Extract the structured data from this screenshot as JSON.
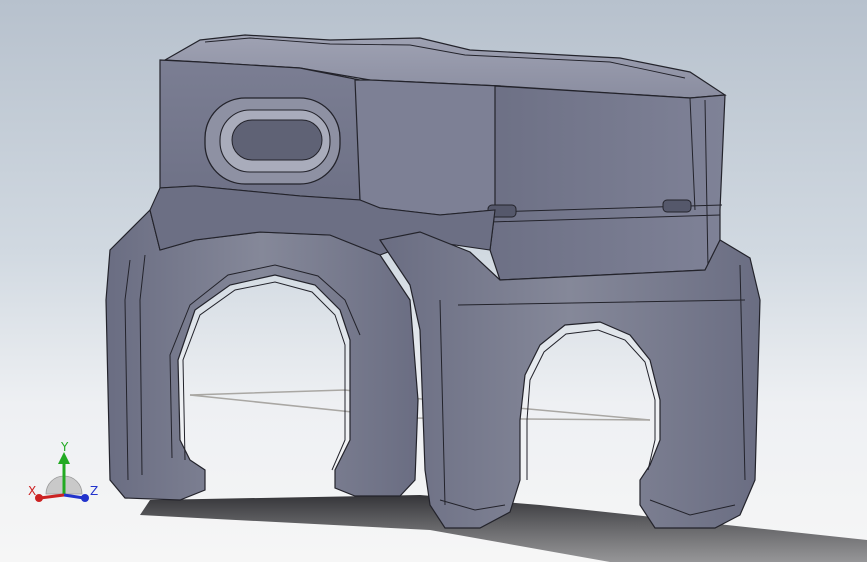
{
  "viewport": {
    "background_top": "#b7c1cd",
    "background_bottom": "#f6f6f6"
  },
  "model": {
    "body_color": "#7a7d93",
    "edge_color": "#23232b",
    "highlight_color": "#a7aabb",
    "shadow_color": "#5b5e72"
  },
  "triad": {
    "x_label": "X",
    "y_label": "Y",
    "z_label": "Z",
    "x_color": "#cc2222",
    "y_color": "#22aa22",
    "z_color": "#2233cc"
  }
}
